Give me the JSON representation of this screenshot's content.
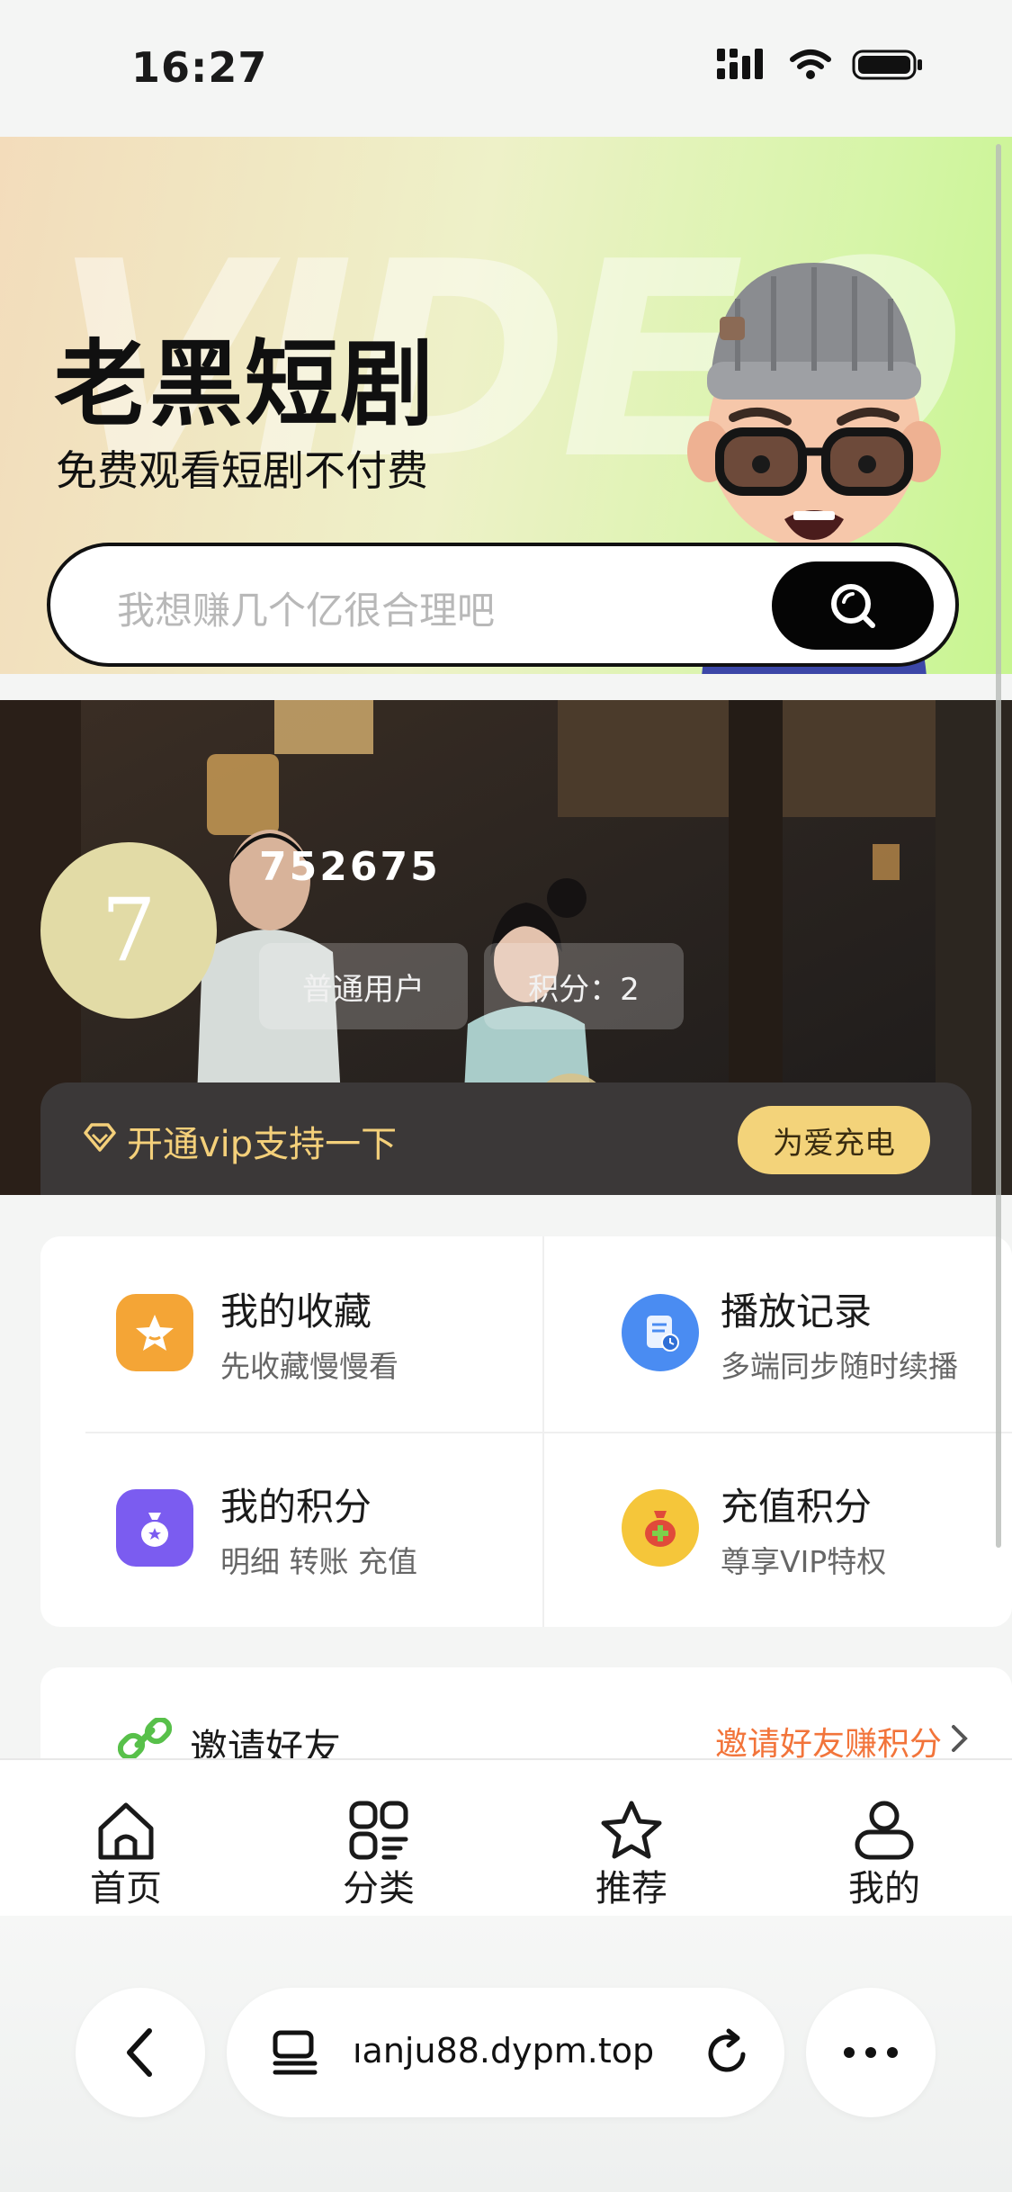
{
  "status_bar": {
    "time": "16:27"
  },
  "hero": {
    "watermark": "VIDEO",
    "title": "老黑短剧",
    "subtitle": "免费观看短剧不付费",
    "search_placeholder": "我想赚几个亿很合理吧"
  },
  "profile": {
    "avatar_text": "7",
    "user_id": "752675",
    "role_tag": "普通用户",
    "points_tag": "积分：2",
    "vip_text": "开通vip支持一下",
    "vip_button": "为爱充电"
  },
  "menu": [
    {
      "title": "我的收藏",
      "subtitle": "先收藏慢慢看",
      "icon": "star-badge-icon",
      "color": "#f4a536"
    },
    {
      "title": "播放记录",
      "subtitle": "多端同步随时续播",
      "icon": "history-doc-icon",
      "color": "#4a8cf2"
    },
    {
      "title": "我的积分",
      "subtitle": "明细 转账 充值",
      "icon": "points-bag-icon",
      "color": "#7b5cf0"
    },
    {
      "title": "充值积分",
      "subtitle": "尊享VIP特权",
      "icon": "money-bag-icon",
      "color": "#f5c63a"
    }
  ],
  "invite": {
    "title": "邀请好友",
    "link": "邀请好友赚积分"
  },
  "tabbar": [
    {
      "label": "首页",
      "icon": "home-icon"
    },
    {
      "label": "分类",
      "icon": "category-icon"
    },
    {
      "label": "推荐",
      "icon": "star-icon"
    },
    {
      "label": "我的",
      "icon": "user-icon"
    }
  ],
  "browser": {
    "url": "ıanju88.dypm.top"
  }
}
